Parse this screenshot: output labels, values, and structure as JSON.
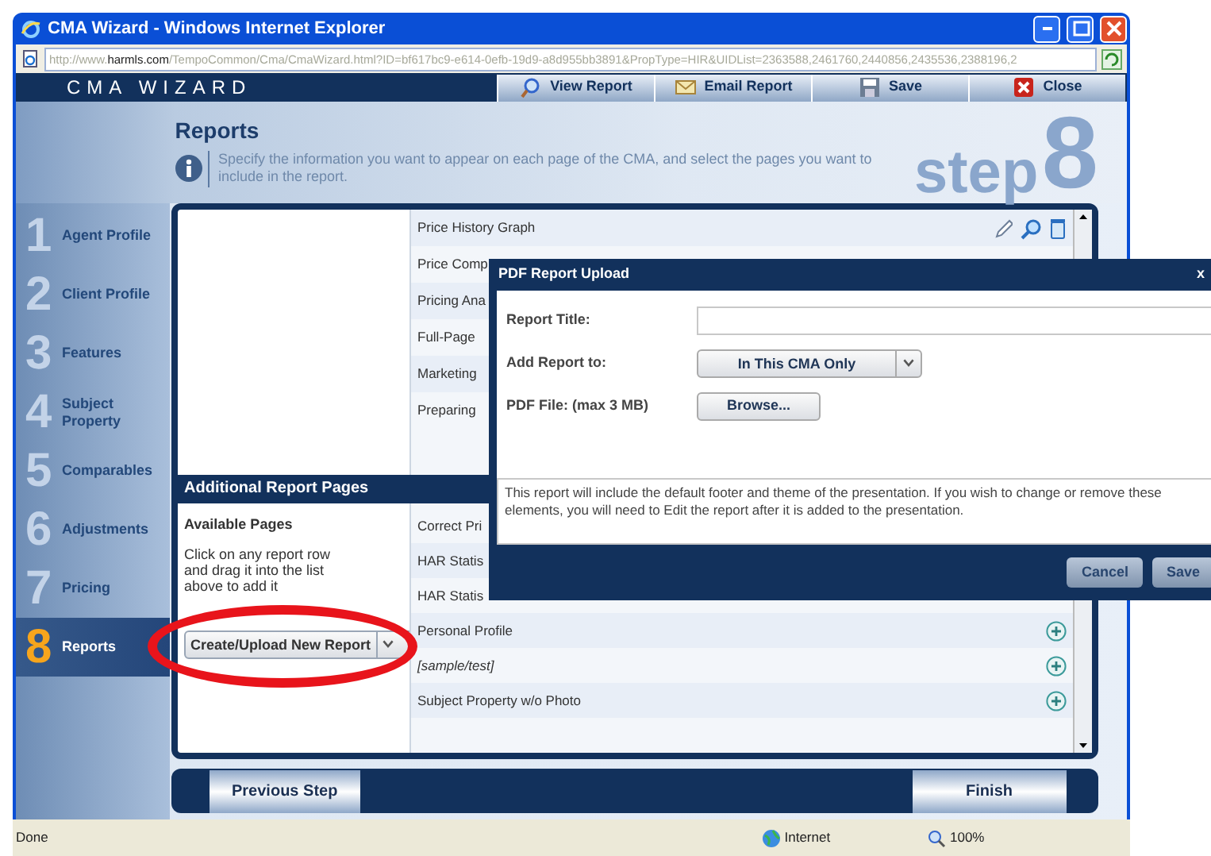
{
  "window": {
    "title": "CMA Wizard - Windows Internet Explorer",
    "url": "http://www.**harmls.com**/TempoCommon/Cma/CmaWizard.html?ID=bf617bc9-e614-0efb-19d9-a8d955bb3891&PropType=HIR&UIDList=2363588,2461760,2440856,2435536,2388196,2"
  },
  "app": {
    "logo": "CMA WIZARD",
    "toolbar": [
      {
        "kind": "view",
        "label": "View Report"
      },
      {
        "kind": "email",
        "label": "Email Report"
      },
      {
        "kind": "save",
        "label": "Save"
      },
      {
        "kind": "close",
        "label": "Close"
      }
    ]
  },
  "header": {
    "title": "Reports",
    "description": "Specify the information you want to appear on each page of the CMA, and select the pages you want to include in the report.",
    "step_word": "step",
    "step_number": "8"
  },
  "steps": [
    {
      "number": "1",
      "label": "Agent Profile",
      "selected": false
    },
    {
      "number": "2",
      "label": "Client Profile",
      "selected": false
    },
    {
      "number": "3",
      "label": "Features",
      "selected": false
    },
    {
      "number": "4",
      "label": "Subject Property",
      "selected": false
    },
    {
      "number": "5",
      "label": "Comparables",
      "selected": false
    },
    {
      "number": "6",
      "label": "Adjustments",
      "selected": false
    },
    {
      "number": "7",
      "label": "Pricing",
      "selected": false
    },
    {
      "number": "8",
      "label": "Reports",
      "selected": true
    }
  ],
  "report_pages": [
    {
      "label": "Price History Graph",
      "actions": true
    },
    {
      "label": "Price Comp"
    },
    {
      "label": "Pricing Ana"
    },
    {
      "label": "Full-Page"
    },
    {
      "label": "Marketing"
    },
    {
      "label": "Preparing"
    }
  ],
  "additional": {
    "title": "Additional Report Pages",
    "available_title": "Available Pages",
    "instructions": "Click on any report row and drag it into the list above to add it",
    "create_button": "Create/Upload New Report",
    "pages": [
      {
        "label": "Correct Pri",
        "italic": false
      },
      {
        "label": "HAR Statis",
        "italic": false
      },
      {
        "label": "HAR Statis",
        "italic": false
      },
      {
        "label": "Personal Profile",
        "italic": false,
        "add": true
      },
      {
        "label": "[sample/test]",
        "italic": true,
        "add": true
      },
      {
        "label": "Subject Property w/o Photo",
        "italic": false,
        "add": true
      }
    ]
  },
  "nav": {
    "previous": "Previous Step",
    "finish": "Finish"
  },
  "status_bar": {
    "text": "Done",
    "zone": "Internet",
    "zoom": "100%"
  },
  "dialog": {
    "title": "PDF Report Upload",
    "close": "x",
    "fields": [
      {
        "kind": "text",
        "label": "Report Title:"
      },
      {
        "kind": "select",
        "label": "Add Report to:",
        "value": "In This CMA Only"
      },
      {
        "kind": "file",
        "label": "PDF File: (max 3 MB)",
        "button": "Browse..."
      }
    ],
    "note": "This report will include the default footer and theme of the presentation. If you wish to change or remove these elements, you will need to Edit the report after it is added to the presentation.",
    "buttons": [
      "Cancel",
      "Save"
    ]
  },
  "highlight": {
    "kind": "ellipse"
  }
}
